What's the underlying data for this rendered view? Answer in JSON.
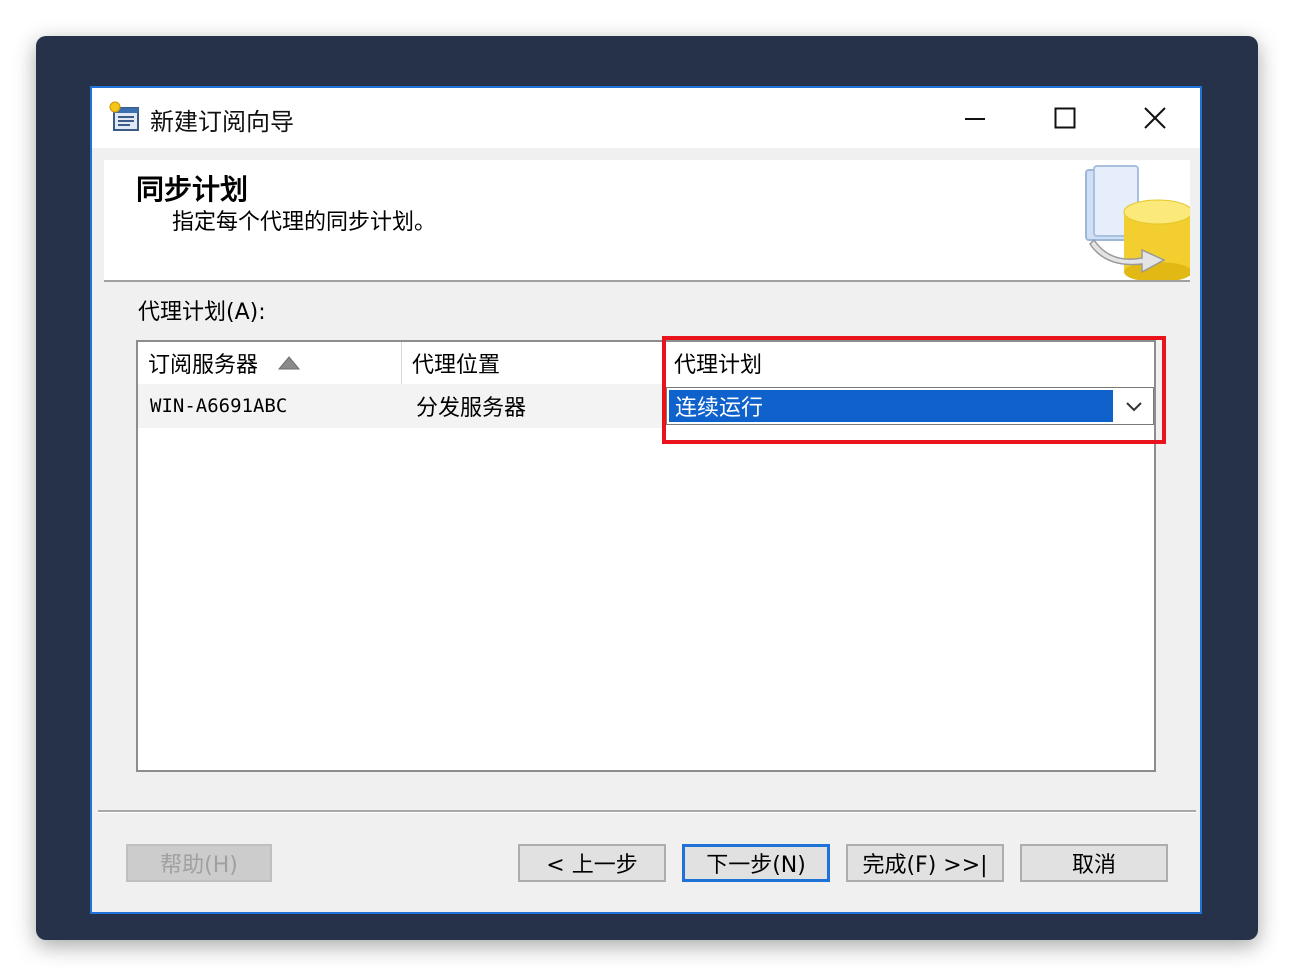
{
  "window": {
    "title": "新建订阅向导"
  },
  "header": {
    "title": "同步计划",
    "description": "指定每个代理的同步计划。"
  },
  "grid": {
    "label": "代理计划(A):",
    "columns": [
      "订阅服务器",
      "代理位置",
      "代理计划"
    ],
    "rows": [
      {
        "subscriber": "WIN-A6691ABC",
        "location": "分发服务器",
        "schedule": "连续运行"
      }
    ]
  },
  "buttons": {
    "help": "帮助(H)",
    "back": "< 上一步",
    "next": "下一步(N)",
    "finish": "完成(F) >>|",
    "cancel": "取消"
  },
  "colors": {
    "accent": "#1f72d6",
    "selection": "#0f62cc",
    "highlight": "#e8131b",
    "desktop": "#25324a"
  },
  "icons": [
    "wizard-app-icon",
    "minimize-icon",
    "maximize-icon",
    "close-icon",
    "sort-ascending-icon",
    "chevron-down-icon",
    "database-wizard-art"
  ]
}
